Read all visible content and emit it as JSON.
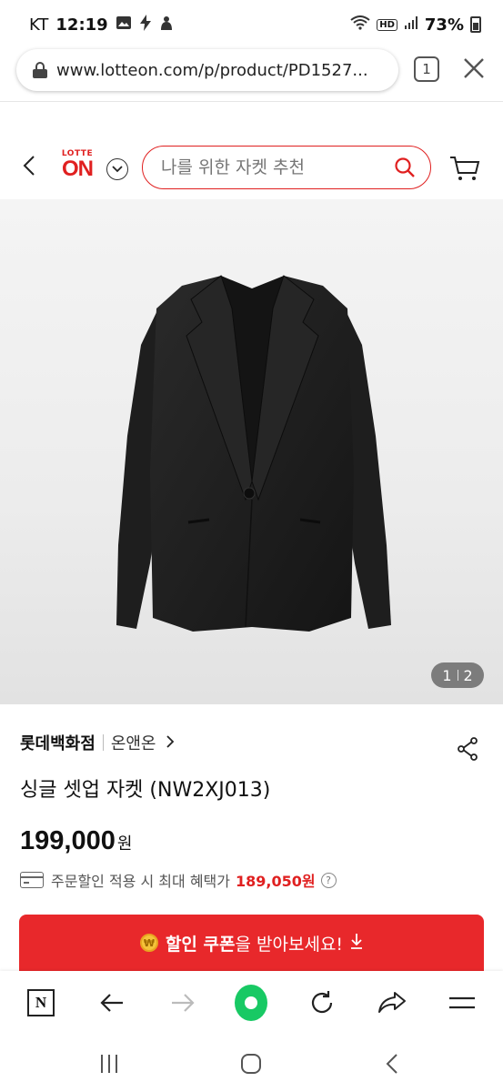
{
  "status_bar": {
    "carrier": "KT",
    "time": "12:19",
    "hd": "HD",
    "battery": "73%"
  },
  "browser": {
    "url": "www.lotteon.com/p/product/PD1527...",
    "tab_count": "1"
  },
  "header": {
    "logo_small": "LOTTE",
    "logo_big": "ON",
    "search_placeholder": "나를 위한 자켓 추천"
  },
  "gallery": {
    "current": "1",
    "total": "2"
  },
  "product": {
    "brand": "롯데백화점",
    "sub_brand": "온앤온",
    "title": "싱글 셋업 자켓 (NW2XJ013)",
    "price": "199,000",
    "price_unit": "원",
    "benefit_label": "주문할인 적용 시 최대 혜택가",
    "benefit_price": "189,050원"
  },
  "coupon": {
    "strong": "할인 쿠폰",
    "rest": "을 받아보세요!"
  },
  "colors": {
    "brand_red": "#e02020",
    "coupon_red": "#e8282b",
    "green": "#18c964"
  }
}
